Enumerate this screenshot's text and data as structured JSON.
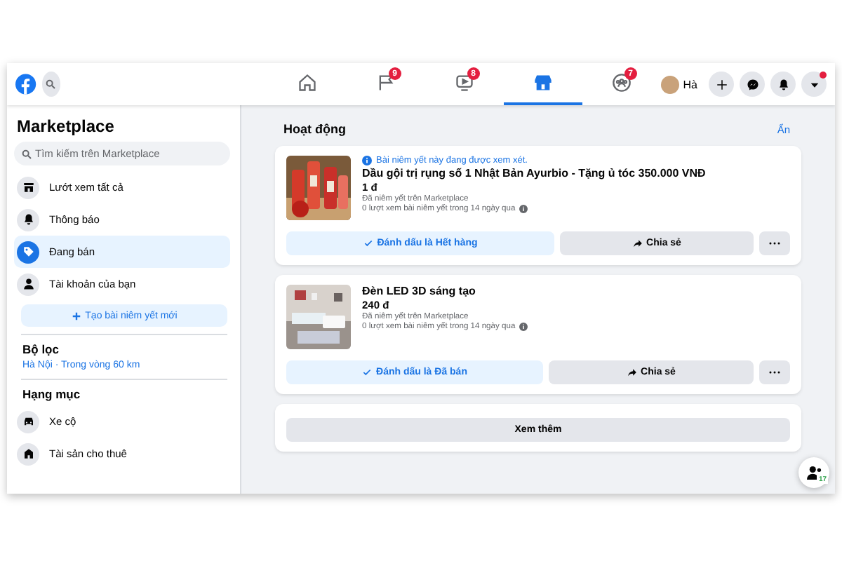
{
  "topbar": {
    "nav_tabs": [
      {
        "kind": "home",
        "selected": false
      },
      {
        "kind": "flag",
        "selected": false,
        "badge": "9"
      },
      {
        "kind": "video",
        "selected": false,
        "badge": "8"
      },
      {
        "kind": "store",
        "selected": true
      },
      {
        "kind": "groups",
        "selected": false,
        "badge": "7"
      }
    ],
    "profile": {
      "name": "Hà"
    },
    "actions": [
      {
        "kind": "plus",
        "notified": false
      },
      {
        "kind": "messenger",
        "notified": false
      },
      {
        "kind": "bell",
        "notified": false
      },
      {
        "kind": "caret",
        "notified": true
      }
    ]
  },
  "sidebar": {
    "title": "Marketplace",
    "search": {
      "placeholder": "Tìm kiếm trên Marketplace"
    },
    "items": [
      {
        "kind": "store",
        "label": "Lướt xem tất cả",
        "selected": false
      },
      {
        "kind": "bell",
        "label": "Thông báo",
        "selected": false
      },
      {
        "kind": "tag",
        "label": "Đang bán",
        "selected": true
      },
      {
        "kind": "person",
        "label": "Tài khoản của bạn",
        "selected": false
      }
    ],
    "create_button": "Tạo bài niêm yết mới",
    "filter": {
      "heading": "Bộ lọc",
      "location": "Hà Nội · Trong vòng 60 km"
    },
    "categories": {
      "heading": "Hạng mục",
      "items": [
        {
          "kind": "car",
          "label": "Xe cộ"
        },
        {
          "kind": "house",
          "label": "Tài sản cho thuê"
        }
      ]
    }
  },
  "main": {
    "heading": "Hoạt động",
    "hide_link": "Ẩn",
    "listings": [
      {
        "notice": "Bài niêm yết này đang được xem xét.",
        "title": "Dầu gội trị rụng số 1 Nhật Bản Ayurbio - Tặng ủ tóc 350.000 VNĐ",
        "price": "1 đ",
        "status": "Đã niêm yết trên Marketplace",
        "views": "0 lượt xem bài niêm yết trong 14 ngày qua",
        "mark_button": "Đánh dấu là Hết hàng",
        "share_button": "Chia sẻ"
      },
      {
        "title": "Đèn LED 3D sáng tạo",
        "price": "240 đ",
        "status": "Đã niêm yết trên Marketplace",
        "views": "0 lượt xem bài niêm yết trong 14 ngày qua",
        "mark_button": "Đánh dấu là Đã bán",
        "share_button": "Chia sẻ"
      }
    ],
    "more_button": "Xem thêm"
  },
  "contacts_button": {
    "badge": "17"
  }
}
